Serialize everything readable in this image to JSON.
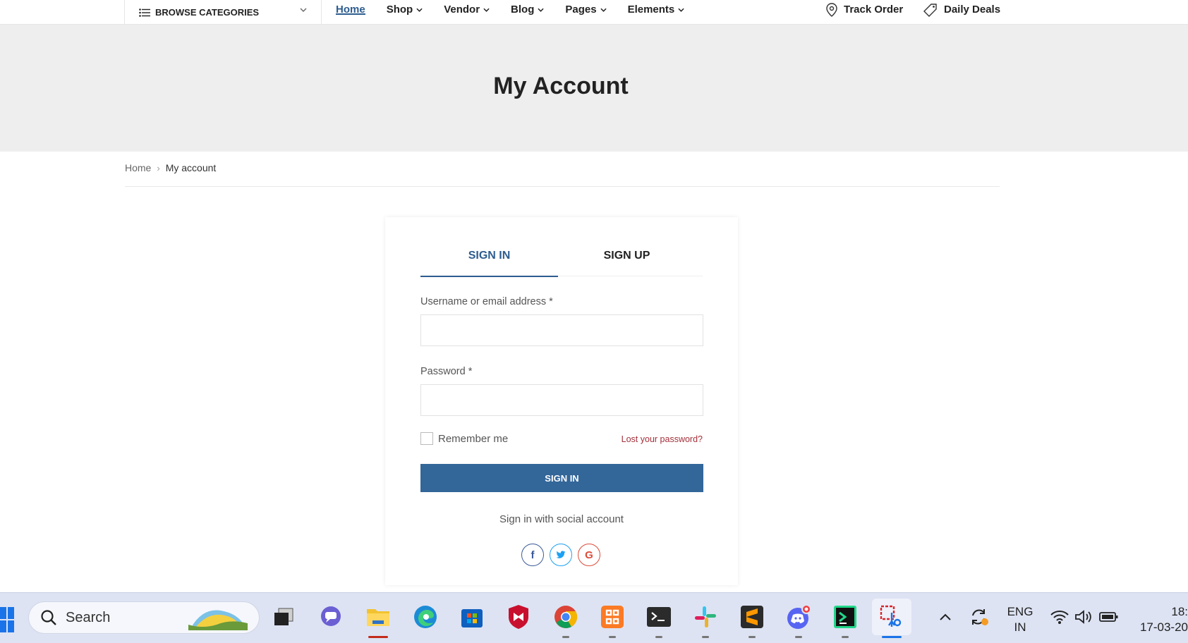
{
  "nav": {
    "browse_label": "BROWSE CATEGORIES",
    "links": [
      {
        "label": "Home",
        "active": true,
        "dropdown": false
      },
      {
        "label": "Shop",
        "active": false,
        "dropdown": true
      },
      {
        "label": "Vendor",
        "active": false,
        "dropdown": true
      },
      {
        "label": "Blog",
        "active": false,
        "dropdown": true
      },
      {
        "label": "Pages",
        "active": false,
        "dropdown": true
      },
      {
        "label": "Elements",
        "active": false,
        "dropdown": true
      }
    ],
    "track_order": "Track Order",
    "daily_deals": "Daily Deals"
  },
  "hero": {
    "title": "My Account"
  },
  "breadcrumb": {
    "home": "Home",
    "current": "My account"
  },
  "form": {
    "tab_signin": "SIGN IN",
    "tab_signup": "SIGN UP",
    "username_label": "Username or email address",
    "password_label": "Password",
    "required_mark": "*",
    "username_value": "",
    "password_value": "",
    "remember_label": "Remember me",
    "lost_password": "Lost your password?",
    "signin_button": "SIGN IN",
    "social_text": "Sign in with social account",
    "social": [
      "f",
      "t",
      "G"
    ]
  },
  "taskbar": {
    "search_placeholder": "Search",
    "lang_line1": "ENG",
    "lang_line2": "IN",
    "time": "18:",
    "date": "17-03-20"
  },
  "colors": {
    "accent": "#336699",
    "active_link": "#2d5d8f",
    "lost_link": "#a3303a",
    "hero_bg": "#eeeeee"
  }
}
